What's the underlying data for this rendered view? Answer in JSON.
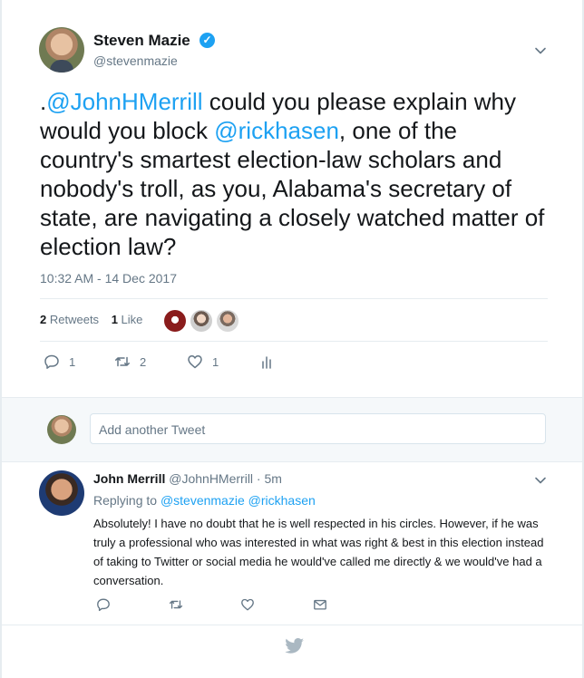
{
  "main_tweet": {
    "author_name": "Steven Mazie",
    "author_handle": "@stevenmazie",
    "text_prefix": ".",
    "mention_1": "@JohnHMerrill",
    "text_mid": " could you please explain why would you block ",
    "mention_2": "@rickhasen",
    "text_suffix": ", one of the country's smartest election-law scholars and nobody's troll, as you, Alabama's secretary of state, are navigating a closely watched matter of election law?",
    "timestamp": "10:32 AM - 14 Dec 2017",
    "retweets_count": "2",
    "retweets_label": "Retweets",
    "likes_count": "1",
    "likes_label": "Like",
    "reply_count": "1",
    "retweet_count": "2",
    "like_count": "1"
  },
  "reply_box": {
    "placeholder": "Add another Tweet"
  },
  "reply_tweet": {
    "author_name": "John Merrill",
    "author_handle": "@JohnHMerrill · 5m",
    "replying_label": "Replying to",
    "replying_to_1": "@stevenmazie",
    "replying_to_2": "@rickhasen",
    "text": "Absolutely! I have no doubt that he is well respected in his circles. However, if he was truly a professional who was interested in what was right & best in this election instead of taking to Twitter or social media he would've called me directly & we would've had a conversation."
  },
  "icons": {
    "verified": "verified-badge-icon",
    "reply": "reply-icon",
    "retweet": "retweet-icon",
    "like": "heart-icon",
    "analytics": "analytics-icon",
    "dm": "envelope-icon",
    "more": "chevron-down-icon",
    "brand": "twitter-bird-icon"
  },
  "colors": {
    "accent": "#1da1f2",
    "muted": "#657786",
    "text": "#14171a",
    "divider": "#e6ecf0"
  }
}
